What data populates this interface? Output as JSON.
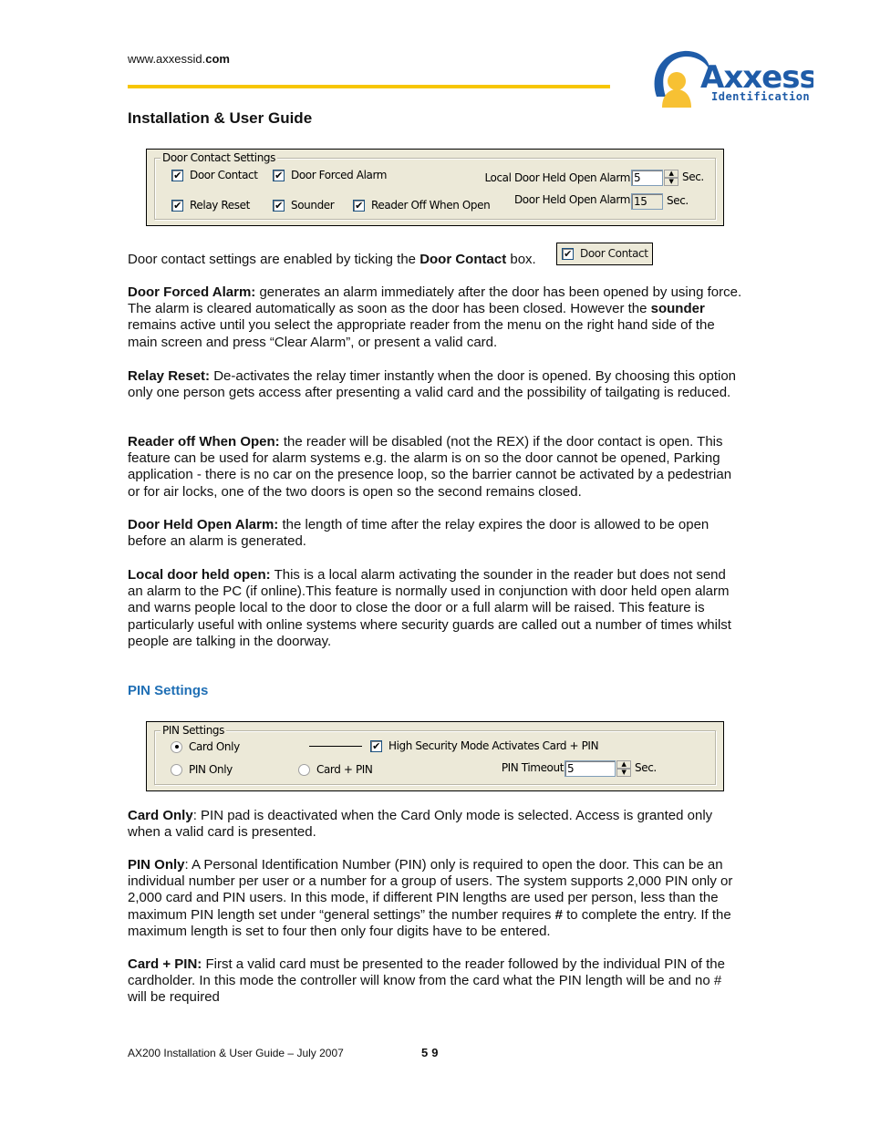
{
  "header": {
    "url_prefix": "www.axxessid.",
    "url_suffix": "com",
    "logo": {
      "brand": "Axxess",
      "tagline": "Identification",
      "brand_color": "#1f5ca8",
      "accent_color": "#f7c133"
    },
    "rule_color": "#f7c600"
  },
  "doc_title": "Installation & User Guide",
  "door_contact_panel": {
    "legend": "Door Contact Settings",
    "checkboxes": [
      {
        "label": "Door Contact",
        "checked": true
      },
      {
        "label": "Door Forced Alarm",
        "checked": true
      },
      {
        "label": "Relay Reset",
        "checked": true
      },
      {
        "label": "Sounder",
        "checked": true
      },
      {
        "label": "Reader Off When Open",
        "checked": true
      }
    ],
    "local_door_held_open_alarm": {
      "label": "Local Door Held Open Alarm",
      "value": "5",
      "unit": "Sec."
    },
    "door_held_open_alarm": {
      "label": "Door Held Open Alarm",
      "value": "15",
      "unit": "Sec."
    }
  },
  "intro": {
    "before": "Door contact settings are enabled by ticking the ",
    "bold": "Door Contact",
    "after": " box.",
    "inline_checkbox_label": "Door Contact"
  },
  "paragraphs": {
    "door_forced": {
      "term": "Door Forced Alarm:",
      "text1": " generates an alarm immediately after the door has been opened by using force. The alarm is cleared automatically as soon as the door has been closed. However the ",
      "bold2": "sounder",
      "text2": " remains active until you select the appropriate reader from the menu on the right hand side of the main screen and press “Clear Alarm”, or present a valid card."
    },
    "relay_reset": {
      "term": "Relay Reset:",
      "text": " De-activates the relay timer instantly when the door is opened. By choosing this option only one person gets access after presenting a valid card and the possibility of tailgating is reduced."
    },
    "reader_off": {
      "term": "Reader off When Open:",
      "text": " the reader will be disabled (not the REX) if the door contact is open. This feature can be used for alarm systems e.g. the alarm is on so the door cannot be opened, Parking application - there is no car on the presence loop, so the barrier cannot be activated by a pedestrian or for air locks, one of the two doors is open so the second remains closed."
    },
    "door_held_open": {
      "term": "Door Held Open Alarm:",
      "text": " the length of time after the relay expires the door is allowed to be open before an alarm is generated."
    },
    "local_door_held": {
      "term": "Local door held open:",
      "text": " This is a local alarm activating the sounder in the reader but does not send an alarm to the PC (if online).This feature is normally used in conjunction with door held open alarm and warns people local to the door to close the door or a full alarm will be raised. This feature is particularly useful with online systems where security guards are called out a number of times whilst people are talking in the doorway."
    },
    "card_only": {
      "term": "Card Only",
      "text": ": PIN pad is deactivated when the Card Only mode is selected. Access is granted only when a valid card is presented."
    },
    "pin_only": {
      "term": "PIN Only",
      "text1": ": A Personal Identification Number (PIN) only is required to open the door. This can be an individual number per user or a number for a group of users. The system supports 2,000 PIN only or 2,000 card and PIN users.  In this mode, if different PIN lengths are used per person, less than the maximum PIN length set under “general settings” the number requires ",
      "bold2": "#",
      "text2": " to complete the entry. If the maximum length is set to four then only four digits have to be entered."
    },
    "card_pin": {
      "term": "Card + PIN:",
      "text": " First a valid card must be presented to the reader followed by the individual PIN of the cardholder. In this mode the controller will know from the card what the PIN length will be and no # will be required"
    }
  },
  "pin_section_heading": "PIN Settings",
  "pin_panel": {
    "legend": "PIN Settings",
    "radios": [
      {
        "label": "Card Only",
        "selected": true
      },
      {
        "label": "PIN Only",
        "selected": false
      },
      {
        "label": "Card + PIN",
        "selected": false
      }
    ],
    "high_security": {
      "label": "High Security Mode Activates Card + PIN",
      "checked": true
    },
    "pin_timeout": {
      "label": "PIN Timeout",
      "value": "5",
      "unit": "Sec."
    }
  },
  "footer": {
    "text": "AX200 Installation & User Guide – July 2007",
    "page_number": "59"
  }
}
